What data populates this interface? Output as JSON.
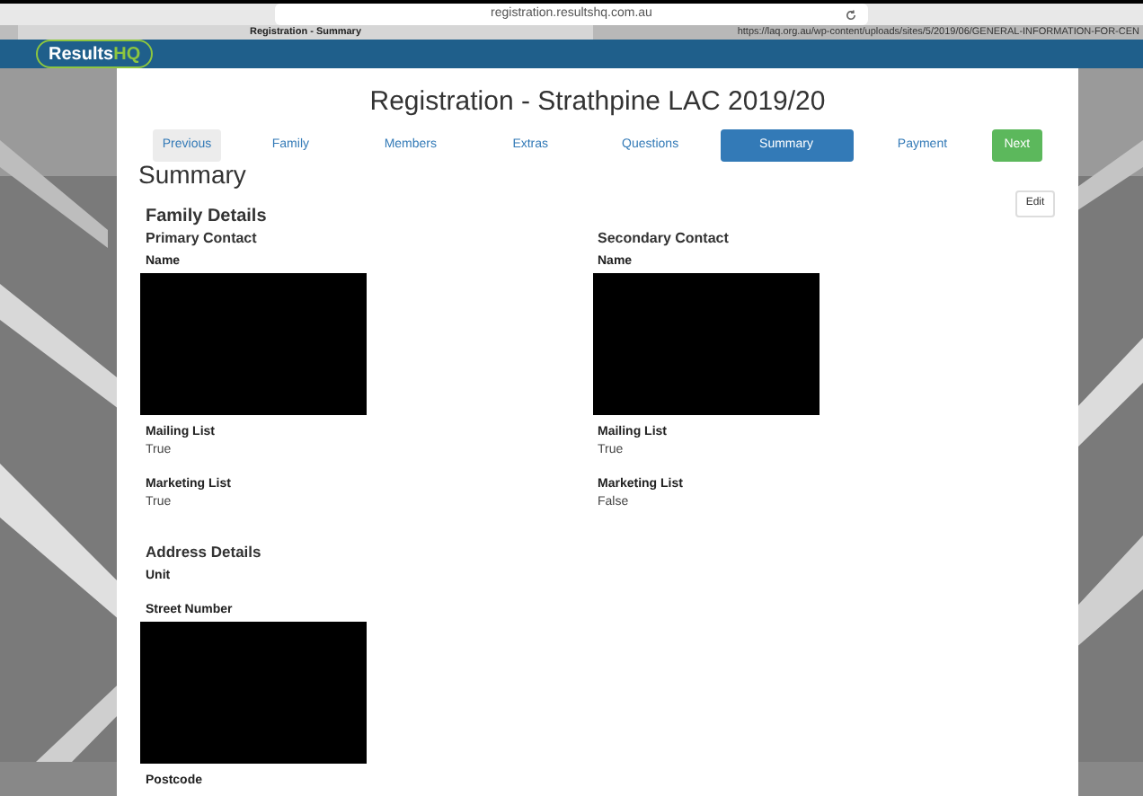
{
  "browser": {
    "url": "registration.resultshq.com.au",
    "tabs": [
      {
        "label": "Registration - Summary",
        "selected": true
      },
      {
        "label": "https://laq.org.au/wp-content/uploads/sites/5/2019/06/GENERAL-INFORMATION-FOR-CEN",
        "selected": false
      }
    ]
  },
  "header": {
    "logo": {
      "text": "Results",
      "accent": "HQ"
    }
  },
  "page": {
    "title": "Registration - Strathpine LAC 2019/20",
    "steps": [
      {
        "label": "Previous",
        "kind": "prev",
        "selected": false
      },
      {
        "label": "Family",
        "kind": "step",
        "selected": false
      },
      {
        "label": "Members",
        "kind": "step",
        "selected": false
      },
      {
        "label": "Extras",
        "kind": "step",
        "selected": false
      },
      {
        "label": "Questions",
        "kind": "step",
        "selected": false
      },
      {
        "label": "Summary",
        "kind": "step",
        "selected": true
      },
      {
        "label": "Payment",
        "kind": "step",
        "selected": false
      },
      {
        "label": "Next",
        "kind": "next",
        "selected": false
      }
    ],
    "heading": "Summary",
    "edit_button": "Edit",
    "family": {
      "title": "Family Details",
      "contacts": [
        {
          "title": "Primary Contact",
          "fields": [
            {
              "label": "Name",
              "redacted": true
            },
            {
              "label": "Mailing List",
              "value": "True"
            },
            {
              "label": "Marketing List",
              "value": "True"
            }
          ]
        },
        {
          "title": "Secondary Contact",
          "fields": [
            {
              "label": "Name",
              "redacted": true
            },
            {
              "label": "Mailing List",
              "value": "True"
            },
            {
              "label": "Marketing List",
              "value": "False"
            }
          ]
        }
      ]
    },
    "address": {
      "title": "Address Details",
      "fields": [
        {
          "label": "Unit"
        },
        {
          "label": "Street Number",
          "redacted": true
        },
        {
          "label": "Postcode"
        }
      ]
    }
  }
}
